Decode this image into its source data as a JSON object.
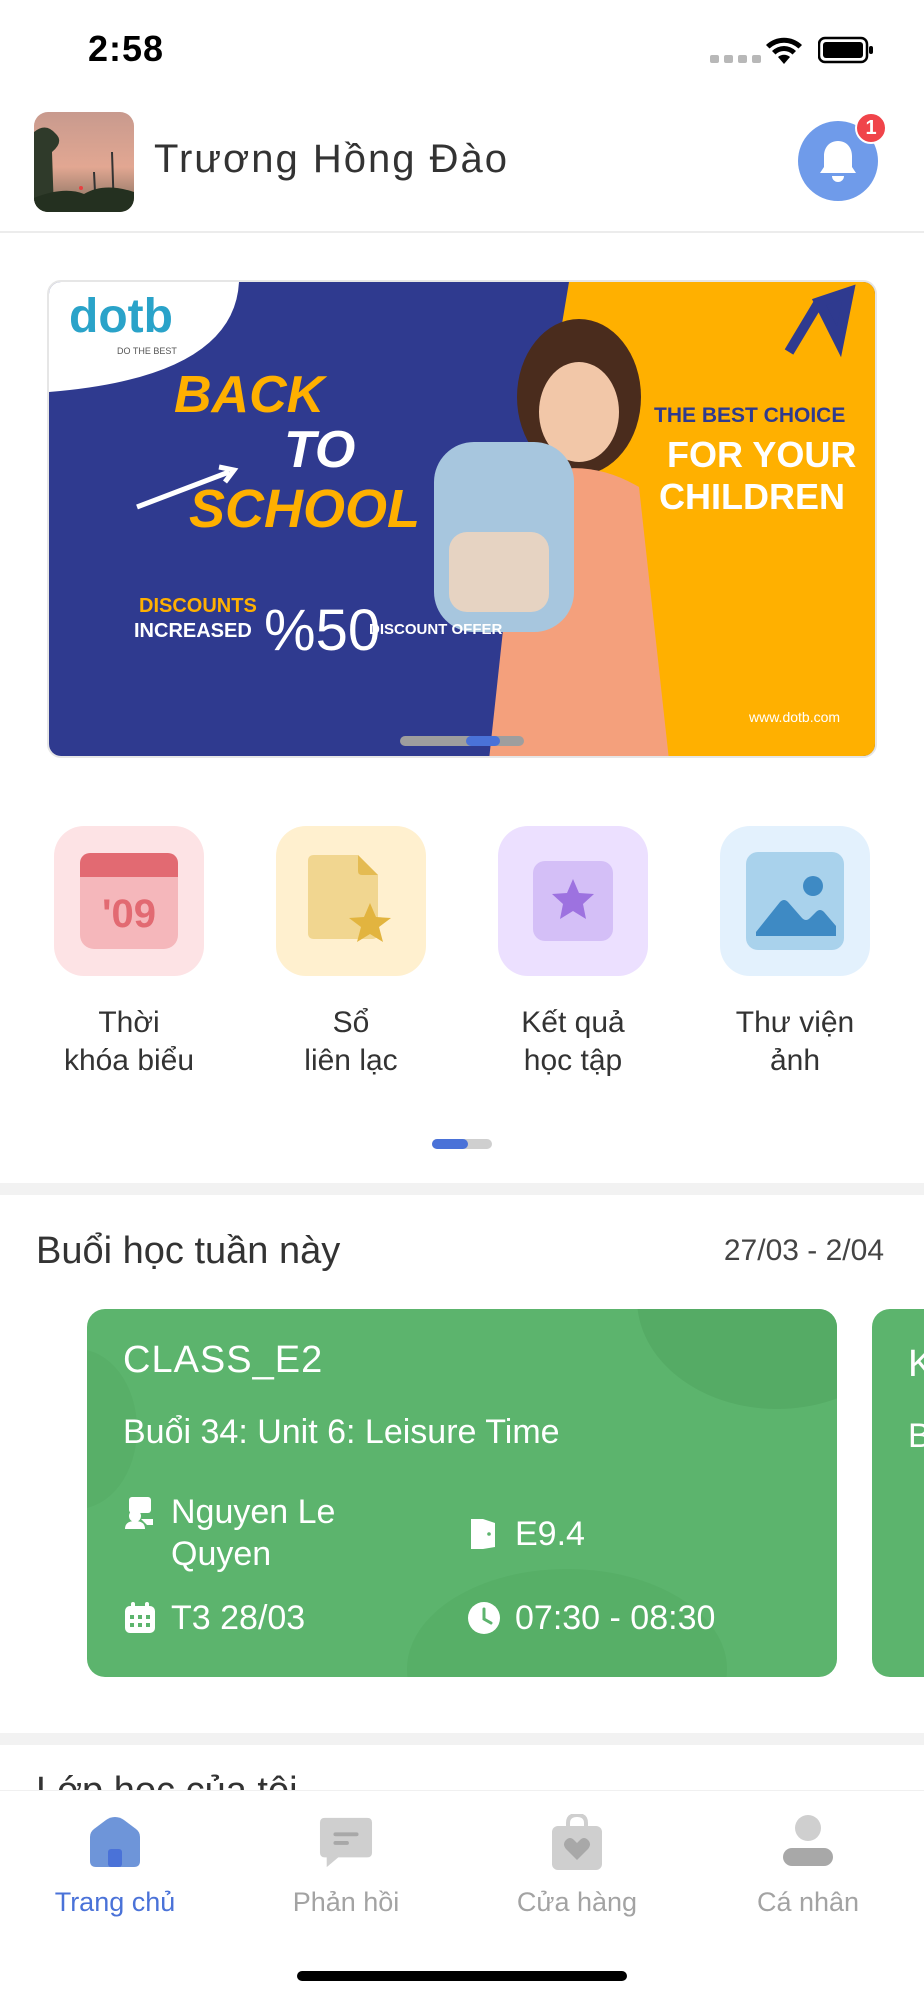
{
  "status_bar": {
    "time": "2:58"
  },
  "header": {
    "user_name": "Trương Hồng Đào",
    "notification_count": "1"
  },
  "banner": {
    "logo_text": "dotb",
    "logo_tagline": "DO THE BEST",
    "headline": [
      "BACK",
      "TO",
      "SCHOOL"
    ],
    "discount_line1": "DISCOUNTS",
    "discount_line2": "INCREASED",
    "discount_value": "%50",
    "discount_offer": "DISCOUNT OFFER",
    "slogan_small": "THE BEST CHOICE",
    "slogan_line2": "FOR YOUR",
    "slogan_line3": "CHILDREN",
    "website": "www.dotb.com",
    "colors": {
      "navy": "#2f3a8f",
      "yellow": "#ffb000",
      "orange_text": "#ffb000"
    }
  },
  "features": [
    {
      "label_1": "Thời",
      "label_2": "khóa biểu",
      "icon": "calendar-icon",
      "icon_text": "'09",
      "tile_color": "#fde3e5"
    },
    {
      "label_1": "Sổ",
      "label_2": "liên lạc",
      "icon": "document-star-icon",
      "tile_color": "#fff0cf"
    },
    {
      "label_1": "Kết quả",
      "label_2": "học tập",
      "icon": "star-card-icon",
      "tile_color": "#ece0ff"
    },
    {
      "label_1": "Thư viện",
      "label_2": "ảnh",
      "icon": "image-icon",
      "tile_color": "#e3f1fd"
    }
  ],
  "weekly": {
    "title": "Buổi học tuần này",
    "date_range": "27/03 - 2/04",
    "lesson": {
      "class_name": "CLASS_E2",
      "lesson_title": "Buổi 34: Unit 6: Leisure Time",
      "teacher_line1": "Nguyen Le",
      "teacher_line2": "Quyen",
      "room": "E9.4",
      "day": "T3 28/03",
      "time": "07:30 - 08:30"
    },
    "next_card": {
      "class_initial": "K",
      "lesson_initial": "B"
    }
  },
  "next_section_title": "Lớp học của tôi",
  "bottom_nav": [
    {
      "label": "Trang chủ",
      "icon": "home-icon",
      "active": true
    },
    {
      "label": "Phản hồi",
      "icon": "chat-icon",
      "active": false
    },
    {
      "label": "Cửa hàng",
      "icon": "shopping-bag-icon",
      "active": false
    },
    {
      "label": "Cá nhân",
      "icon": "user-icon",
      "active": false
    }
  ]
}
